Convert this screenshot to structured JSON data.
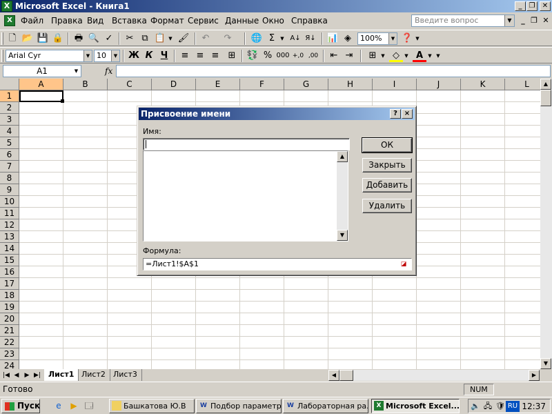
{
  "window": {
    "title": "Microsoft Excel - Книга1"
  },
  "menu": {
    "items": [
      "Файл",
      "Правка",
      "Вид",
      "Вставка",
      "Формат",
      "Сервис",
      "Данные",
      "Окно",
      "Справка"
    ],
    "help_placeholder": "Введите вопрос"
  },
  "toolbar": {
    "zoom": "100%",
    "font": "Arial Cyr",
    "font_size": "10",
    "bold": "Ж",
    "italic": "К",
    "underline": "Ч",
    "autosum": "Σ",
    "percent": "%",
    "thousands": "000"
  },
  "formula_bar": {
    "cell_ref": "A1",
    "fx": "fx",
    "formula": ""
  },
  "grid": {
    "columns": [
      "A",
      "B",
      "C",
      "D",
      "E",
      "F",
      "G",
      "H",
      "I",
      "J",
      "K",
      "L"
    ],
    "rows": [
      "1",
      "2",
      "3",
      "4",
      "5",
      "6",
      "7",
      "8",
      "9",
      "10",
      "11",
      "12",
      "13",
      "14",
      "15",
      "16",
      "17",
      "18",
      "19",
      "20",
      "21",
      "22",
      "23",
      "24"
    ],
    "active_cell": "A1"
  },
  "sheets": {
    "tabs": [
      "Лист1",
      "Лист2",
      "Лист3"
    ],
    "active": "Лист1"
  },
  "status": {
    "text": "Готово",
    "num": "NUM"
  },
  "dialog": {
    "title": "Присвоение имени",
    "name_label": "Имя:",
    "name_value": "",
    "formula_label": "Формула:",
    "formula_value": "=Лист1!$A$1",
    "buttons": {
      "ok": "ОК",
      "close": "Закрыть",
      "add": "Добавить",
      "delete": "Удалить"
    },
    "help_btn": "?",
    "close_btn": "×"
  },
  "taskbar": {
    "start": "Пуск",
    "tasks": [
      "Башкатова Ю.В",
      "Подбор параметр...",
      "Лабораторная ра...",
      "Microsoft Excel..."
    ],
    "active_task": "Microsoft Excel...",
    "lang": "RU",
    "clock": "12:37"
  },
  "colors": {
    "title_start": "#0a246a",
    "title_end": "#a6caf0",
    "face": "#d4d0c8",
    "excel_green": "#1e7a2e"
  }
}
